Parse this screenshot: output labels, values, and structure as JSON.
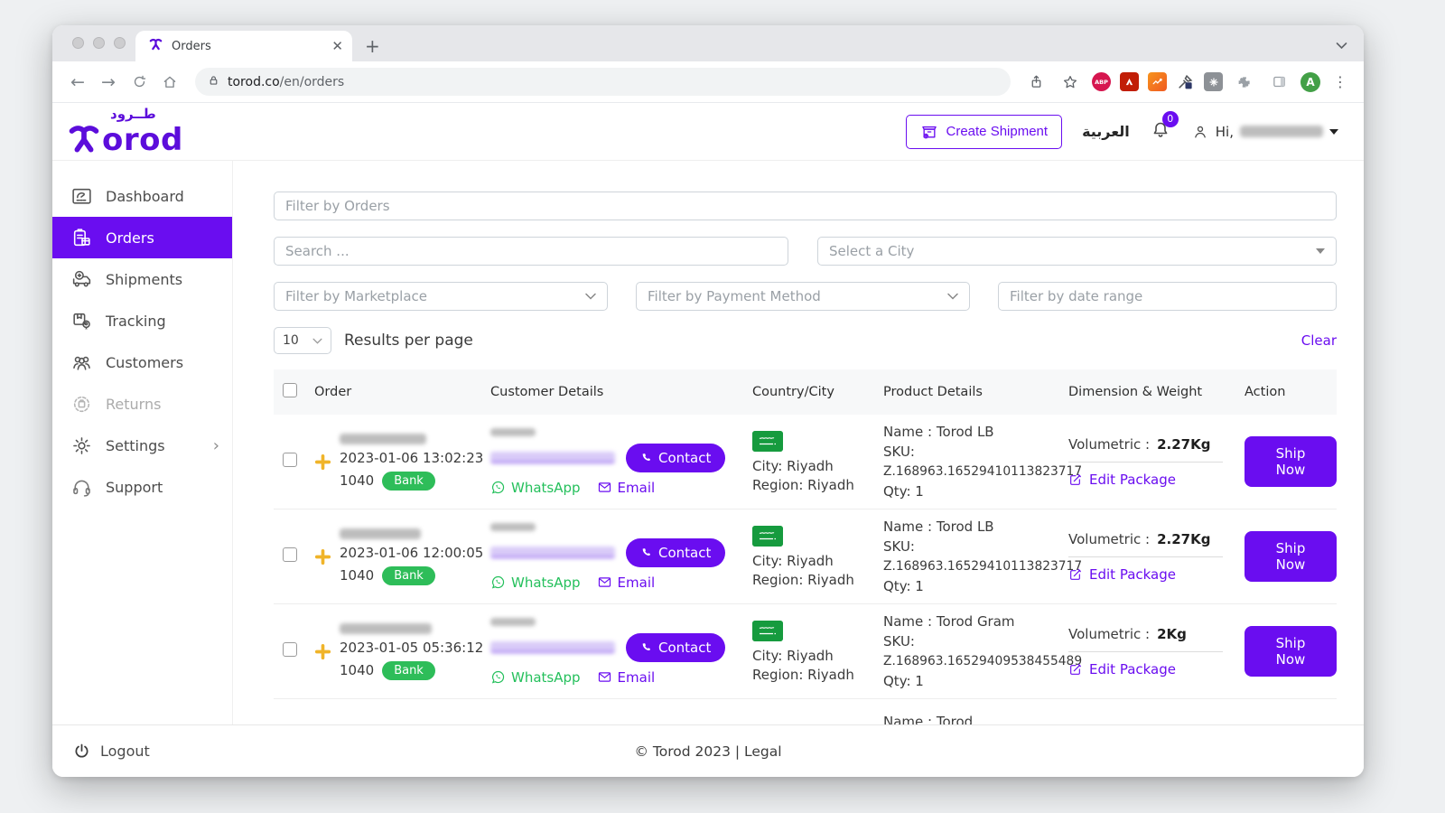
{
  "browser": {
    "tab_title": "Orders",
    "url_domain": "torod.co",
    "url_path": "/en/orders",
    "avatar_letter": "A",
    "abp_label": "ABP"
  },
  "header": {
    "logo_word": "orod",
    "logo_arabic": "طــرود",
    "create_shipment_label": "Create Shipment",
    "language_label": "العربية",
    "notification_count": "0",
    "greeting": "Hi,"
  },
  "sidebar": {
    "items": [
      {
        "label": "Dashboard"
      },
      {
        "label": "Orders"
      },
      {
        "label": "Shipments"
      },
      {
        "label": "Tracking"
      },
      {
        "label": "Customers"
      },
      {
        "label": "Returns"
      },
      {
        "label": "Settings"
      },
      {
        "label": "Support"
      }
    ],
    "logout_label": "Logout"
  },
  "filters": {
    "orders_placeholder": "Filter by Orders",
    "search_placeholder": "Search ...",
    "city_placeholder": "Select a City",
    "marketplace_placeholder": "Filter by Marketplace",
    "payment_placeholder": "Filter by Payment Method",
    "date_placeholder": "Filter by date range",
    "results_per_page_value": "10",
    "results_per_page_label": "Results per page",
    "clear_label": "Clear"
  },
  "table": {
    "headers": [
      "Order",
      "Customer Details",
      "Country/City",
      "Product Details",
      "Dimension & Weight",
      "Action"
    ],
    "labels": {
      "contact": "Contact",
      "whatsapp": "WhatsApp",
      "email": "Email",
      "sku": "SKU:",
      "volumetric": "Volumetric :",
      "edit_package": "Edit Package",
      "ship_now": "Ship Now"
    },
    "rows": [
      {
        "date": "2023-01-06 13:02:23",
        "reference": "1040",
        "payment": "Bank",
        "city": "City: Riyadh",
        "region": "Region: Riyadh",
        "product_name": "Name : Torod LB",
        "sku": "Z.168963.16529410113823717",
        "qty": "Qty: 1",
        "volumetric": "2.27Kg"
      },
      {
        "date": "2023-01-06 12:00:05",
        "reference": "1040",
        "payment": "Bank",
        "city": "City: Riyadh",
        "region": "Region: Riyadh",
        "product_name": "Name : Torod LB",
        "sku": "Z.168963.16529410113823717",
        "qty": "Qty: 1",
        "volumetric": "2.27Kg"
      },
      {
        "date": "2023-01-05 05:36:12",
        "reference": "1040",
        "payment": "Bank",
        "city": "City: Riyadh",
        "region": "Region: Riyadh",
        "product_name": "Name : Torod Gram",
        "sku": "Z.168963.16529409538455489",
        "qty": "Qty: 1",
        "volumetric": "2Kg"
      }
    ],
    "partial_row": {
      "product_name": "Name : Torod"
    }
  },
  "footer": {
    "copyright": "© Torod 2023 | Legal"
  }
}
